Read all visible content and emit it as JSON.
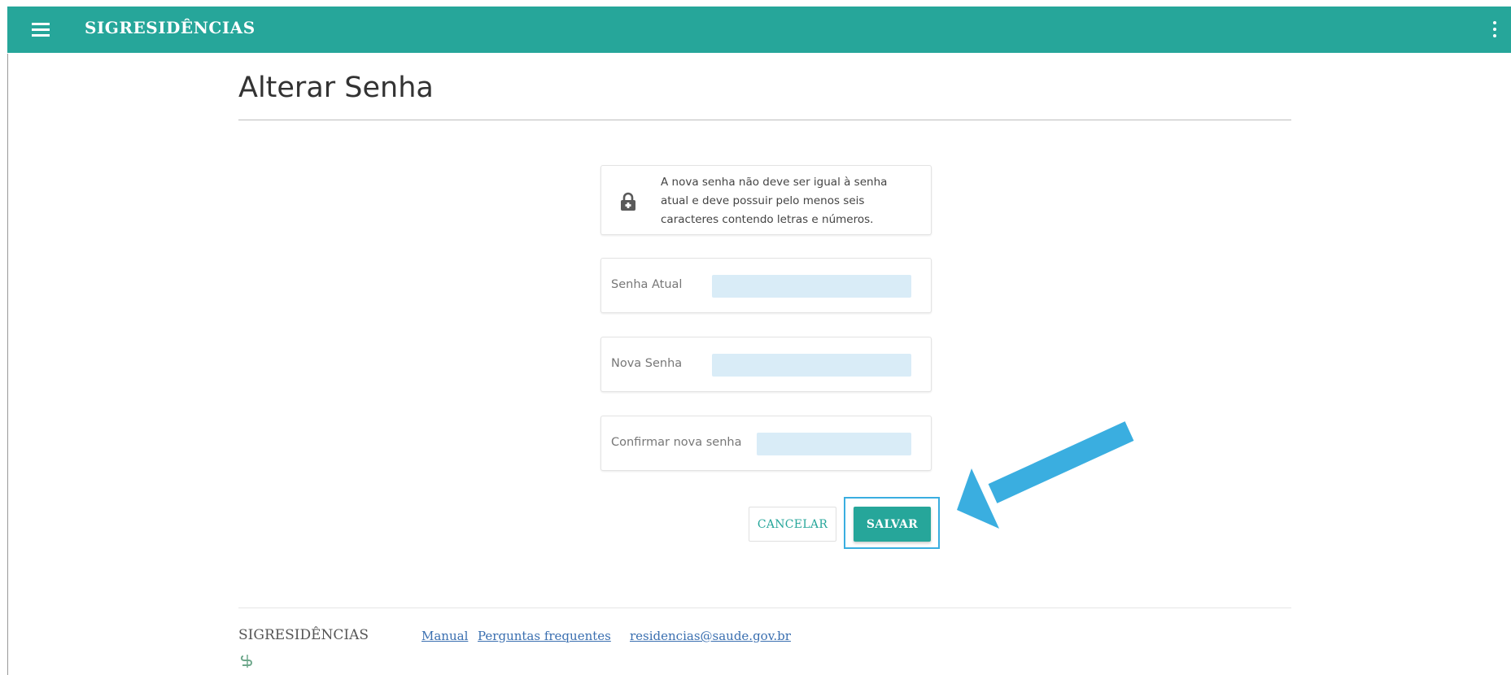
{
  "header": {
    "app_title": "SIGRESIDÊNCIAS",
    "menu_icon": "hamburger-menu-icon",
    "more_icon": "vertical-dots-icon",
    "bar_color": "#26a69a"
  },
  "main": {
    "title": "Alterar Senha",
    "notice": {
      "icon": "lock-icon",
      "line1": "A nova senha não deve ser igual à senha",
      "line2": "atual e deve possuir pelo menos seis",
      "line3": "caracteres contendo letras e números."
    },
    "fields": {
      "current_password": {
        "label": "Senha Atual",
        "value": ""
      },
      "new_password": {
        "label": "Nova Senha",
        "value": ""
      },
      "confirm_password": {
        "label": "Confirmar nova senha",
        "value": ""
      }
    },
    "actions": {
      "cancel_label": "CANCELAR",
      "save_label": "SALVAR"
    },
    "annotation": {
      "arrow_color": "#3aaee0",
      "highlight_color": "#3aaee0"
    }
  },
  "footer": {
    "brand": "SIGRESIDÊNCIAS",
    "links": {
      "manual": "Manual",
      "faq": "Perguntas frequentes",
      "email": "residencias@saude.gov.br"
    },
    "logo_icon": "sus-logo-icon"
  }
}
